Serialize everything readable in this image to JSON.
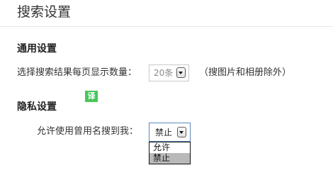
{
  "page": {
    "title": "搜索设置"
  },
  "general": {
    "heading": "通用设置",
    "results_per_page_label": "选择搜索结果每页显示数量：",
    "results_per_page_value": "20条",
    "results_note": "（搜图片和相册除外）"
  },
  "translate_badge": "译",
  "privacy": {
    "heading": "隐私设置",
    "nickname_search_label": "允许使用曾用名搜到我：",
    "nickname_search_value": "禁止",
    "options": [
      "允许",
      "禁止"
    ],
    "selected_option": "禁止"
  },
  "colors": {
    "badge": "#47c65a",
    "focus_border": "#5b88c2",
    "option_highlight": "#b9b9b9"
  }
}
